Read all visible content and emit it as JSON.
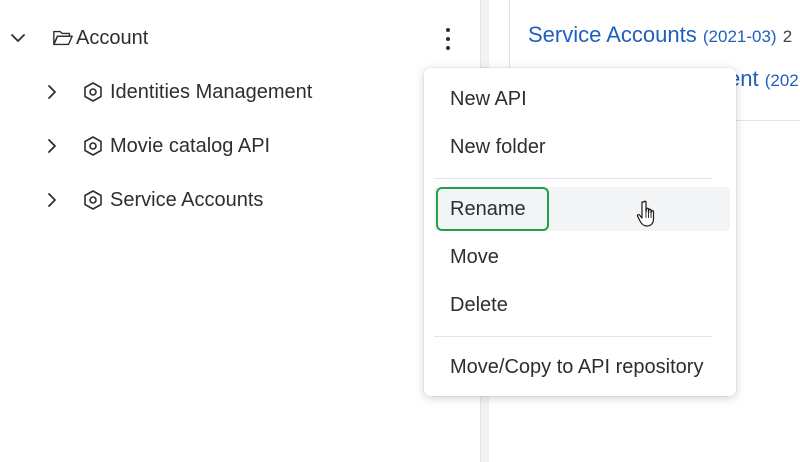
{
  "tree": {
    "root": {
      "label": "Account",
      "expanded": true,
      "icon": "folder-open-icon"
    },
    "children": [
      {
        "label": "Identities Management",
        "icon": "api-hexagon-icon"
      },
      {
        "label": "Movie catalog API",
        "icon": "api-hexagon-icon"
      },
      {
        "label": "Service Accounts",
        "icon": "api-hexagon-icon"
      }
    ]
  },
  "right_panel": {
    "link1": {
      "text": "Service Accounts",
      "date": "(2021-03)",
      "extra": "2"
    },
    "link2": {
      "text": "ent",
      "date": "(202"
    }
  },
  "context_menu": {
    "items": [
      {
        "label": "New API"
      },
      {
        "label": "New folder"
      },
      {
        "label": "Rename",
        "state": "hovered-focused"
      },
      {
        "label": "Move"
      },
      {
        "label": "Delete"
      },
      {
        "label": "Move/Copy to API repository"
      }
    ]
  },
  "colors": {
    "link": "#1f5fbf",
    "focus_ring": "#22a045",
    "hover_bg": "#f3f4f6",
    "text": "#2b2f33"
  }
}
